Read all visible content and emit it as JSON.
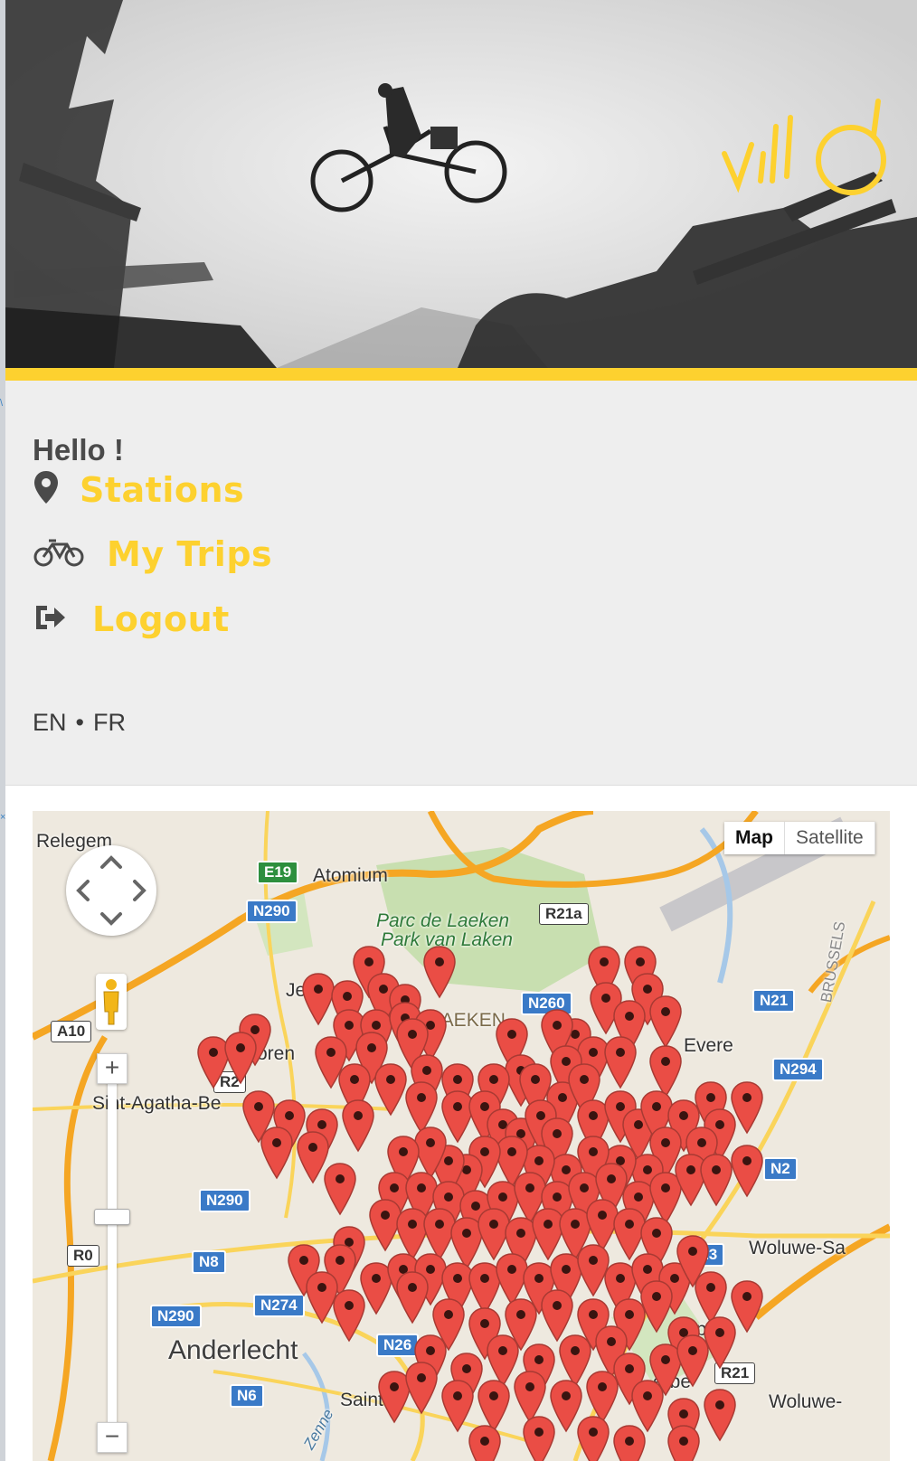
{
  "brand": {
    "logo_text": "villo!"
  },
  "greeting": "Hello !",
  "menu": [
    {
      "label": "Stations",
      "icon": "map-marker-icon"
    },
    {
      "label": "My Trips",
      "icon": "bicycle-icon"
    },
    {
      "label": "Logout",
      "icon": "logout-icon"
    }
  ],
  "languages": [
    "EN",
    "FR"
  ],
  "language_separator": "•",
  "map": {
    "type_buttons": {
      "map": "Map",
      "satellite": "Satellite"
    },
    "zoom": {
      "in": "+",
      "out": "−"
    },
    "places": {
      "relegem": "Relegem",
      "atomium": "Atomium",
      "parc_fr": "Parc de Laeken",
      "parc_nl": "Park van Laken",
      "laeken": "LAEKEN",
      "jette": "Je",
      "oren": "oren",
      "evere": "Evere",
      "brussels": "BRUSSELS",
      "agatha": "Sint-Agatha-Be",
      "woluwe1": "Woluwe-Sa",
      "woluwe2": "Woluwe-",
      "anderlecht": "Anderlecht",
      "saint": "Saint",
      "zenne": "Zenne",
      "erbe": "erbe",
      "opo": "opo"
    },
    "roads": {
      "e19": "E19",
      "n290a": "N290",
      "r21a": "R21a",
      "n260": "N260",
      "n21": "N21",
      "n294": "N294",
      "a10": "A10",
      "r2": "R2",
      "n2": "N2",
      "n290b": "N290",
      "r0": "R0",
      "n8": "N8",
      "n23": "N23",
      "n290c": "N290",
      "n274": "N274",
      "n26": "N26",
      "n6": "N6",
      "r21": "R21"
    },
    "marker_color": "#ea4d45",
    "colors": {
      "accent": "#fdd12f",
      "road_major": "#f5a623",
      "road_minor": "#fad45a",
      "park": "#c8dfb0",
      "water": "#a6c8e8"
    }
  }
}
